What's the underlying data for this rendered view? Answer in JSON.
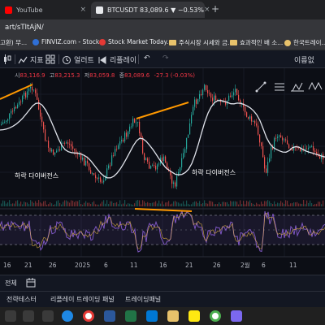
{
  "browser": {
    "tabs": [
      {
        "title": "YouTube",
        "close": "×"
      },
      {
        "title": "BTCUSDT 83,089.6 ▼ −0.53%",
        "close": "×"
      }
    ],
    "new_tab": "+",
    "url": "art/sTItAjN/"
  },
  "bookmarks": [
    {
      "label": "고환) 무..."
    },
    {
      "label": "FINVIZ.com - Stock..."
    },
    {
      "label": "Stock Market Today..."
    },
    {
      "label": "주식시장 시세와 금..."
    },
    {
      "label": "효과적인 배 소..."
    },
    {
      "label": "한국트레이..."
    }
  ],
  "toolbar": {
    "indicators": "지표",
    "alert": "얼러트",
    "replay": "리플레이",
    "undo": "↶",
    "redo": "↷",
    "right_label": "이름없"
  },
  "legend": {
    "open_label": "시",
    "open": "83,116.9",
    "high_label": "고",
    "high": "83,215.3",
    "low_label": "저",
    "low": "83,059.8",
    "close_label": "종",
    "close": "83,089.6",
    "change": "-27.3 (-0.03%)"
  },
  "annotations": [
    {
      "text": "하락 다이버전스"
    },
    {
      "text": "하락 다이버전스"
    }
  ],
  "x_axis": [
    "16",
    "21",
    "26",
    "2025",
    "6",
    "11",
    "16",
    "21",
    "26",
    "2월",
    "6",
    "11"
  ],
  "bottom_bar": {
    "range_all": "전체"
  },
  "panel_tabs": [
    "전략테스터",
    "리플레이 트레이딩 패널",
    "트레이딩패널"
  ],
  "colors": {
    "divergence": "#ff9800",
    "candle_up": "#26a69a",
    "candle_down": "#ef5350",
    "ma": "#e0e3eb",
    "rsi": "#7e57c2"
  }
}
